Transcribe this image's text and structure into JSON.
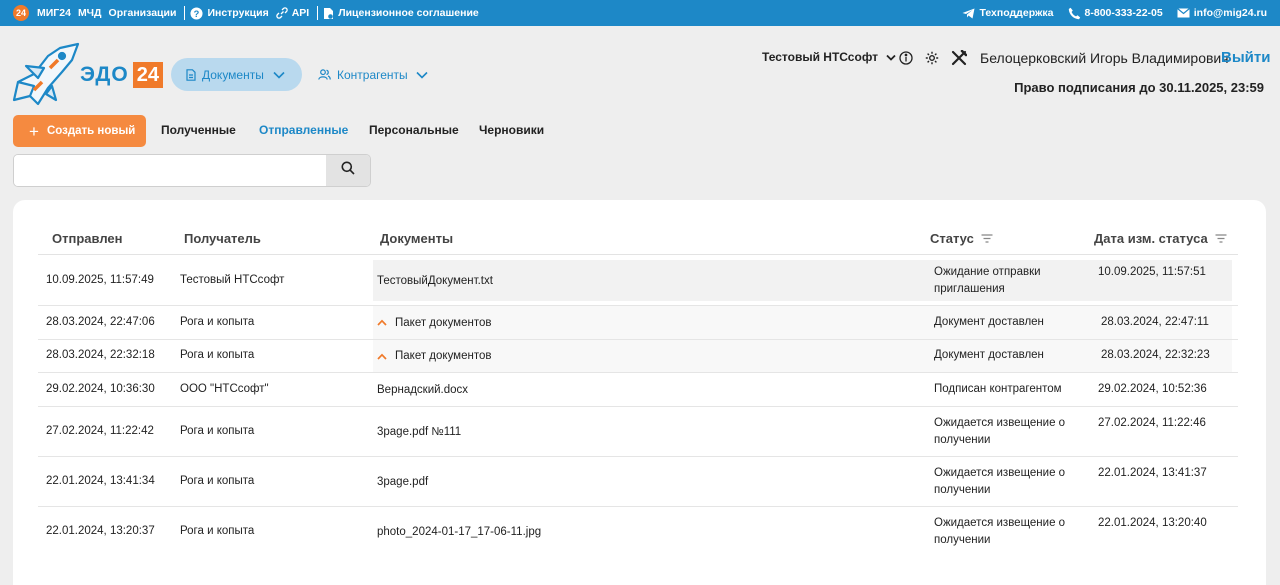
{
  "topbar": {
    "badge": "24",
    "links": [
      "МИГ24",
      "МЧД",
      "Организации"
    ],
    "instruction": "Инструкция",
    "api": "API",
    "license": "Лицензионное соглашение",
    "support": "Техподдержка",
    "phone": "8-800-333-22-05",
    "email": "info@mig24.ru"
  },
  "brand": {
    "text": "ЭДО",
    "num": "24"
  },
  "nav": {
    "documents": "Документы",
    "counterparties": "Контрагенты"
  },
  "header": {
    "org": "Тестовый НТСсофт",
    "user": "Белоцерковский Игорь Владимирович",
    "logout": "Выйти",
    "sign_right": "Право подписания до 30.11.2025, 23:59"
  },
  "toolbar": {
    "create_label": "Создать новый",
    "tabs": [
      "Полученные",
      "Отправленные",
      "Персональные",
      "Черновики"
    ],
    "active_tab": "Отправленные"
  },
  "search": {
    "value": "",
    "placeholder": ""
  },
  "table": {
    "columns": [
      "Отправлен",
      "Получатель",
      "Документы",
      "Статус",
      "Дата изм. статуса"
    ],
    "rows": [
      {
        "sent": "10.09.2025, 11:57:49",
        "recipient": "Тестовый НТСсофт",
        "document": "ТестовыйДокумент.txt",
        "status": "Ожидание отправки приглашения",
        "status_l1": "Ожидание отправки",
        "status_l2": "приглашения",
        "changed": "10.09.2025, 11:57:51"
      },
      {
        "sent": "28.03.2024, 22:47:06",
        "recipient": "Рога и копыта",
        "document": "Пакет документов",
        "status": "Документ доставлен",
        "changed": "28.03.2024, 22:47:11"
      },
      {
        "sent": "28.03.2024, 22:32:18",
        "recipient": "Рога и копыта",
        "document": "Пакет документов",
        "status": "Документ доставлен",
        "changed": "28.03.2024, 22:32:23"
      },
      {
        "sent": "29.02.2024, 10:36:30",
        "recipient": "ООО \"НТСсофт\"",
        "document": "Вернадский.docx",
        "status": "Подписан контрагентом",
        "changed": "29.02.2024, 10:52:36"
      },
      {
        "sent": "27.02.2024, 11:22:42",
        "recipient": "Рога и копыта",
        "document": "3page.pdf №111",
        "status": "Ожидается извещение о получении",
        "status_l1": "Ожидается извещение о",
        "status_l2": "получении",
        "changed": "27.02.2024, 11:22:46"
      },
      {
        "sent": "22.01.2024, 13:41:34",
        "recipient": "Рога и копыта",
        "document": "3page.pdf",
        "status": "Ожидается извещение о получении",
        "status_l1": "Ожидается извещение о",
        "status_l2": "получении",
        "changed": "22.01.2024, 13:41:37"
      },
      {
        "sent": "22.01.2024, 13:20:37",
        "recipient": "Рога и копыта",
        "document": "photo_2024-01-17_17-06-11.jpg",
        "status": "Ожидается извещение о получении",
        "status_l1": "Ожидается извещение о",
        "status_l2": "получении",
        "changed": "22.01.2024, 13:20:40"
      }
    ]
  },
  "icons": {
    "help": "help-circle-icon",
    "api": "link-icon",
    "license": "document-icon",
    "support": "telegram-icon",
    "phone": "phone-icon",
    "email": "mail-icon",
    "info": "info-icon",
    "settings": "gear-icon",
    "tools": "tools-icon",
    "search": "search-icon",
    "filter": "filter-icon",
    "expand": "chevron-up-icon"
  },
  "colors": {
    "accent": "#1d88c7",
    "brand_orange": "#f07a2a",
    "button_orange": "#f58a40"
  }
}
